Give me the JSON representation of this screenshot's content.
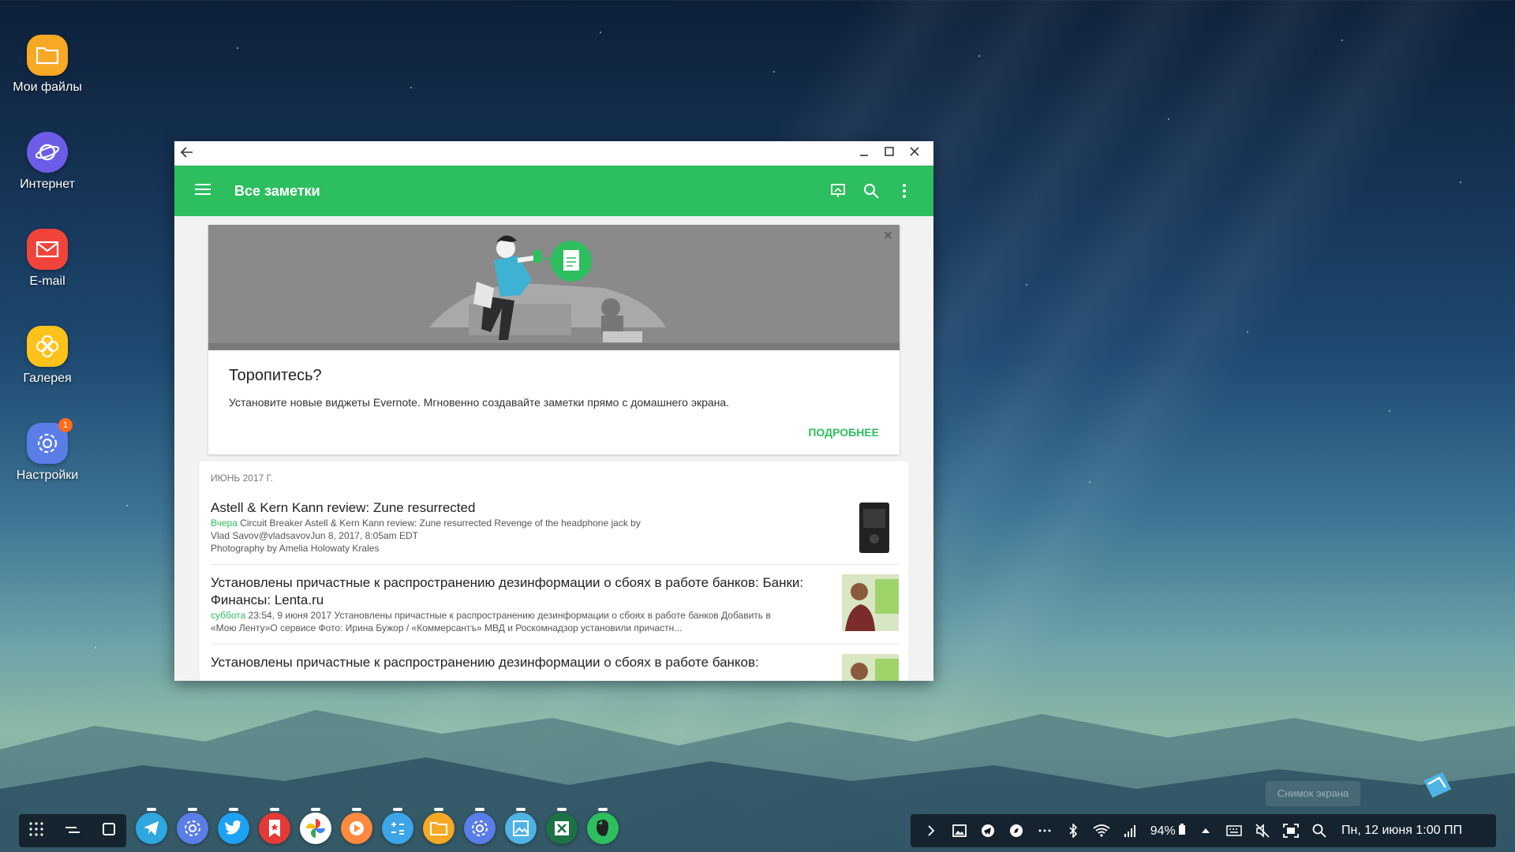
{
  "desktop": {
    "icons": [
      {
        "label": "Мои файлы",
        "icon": "folder-icon",
        "color": "#f7a824"
      },
      {
        "label": "Интернет",
        "icon": "planet-icon",
        "color": "#6c5ce7"
      },
      {
        "label": "E-mail",
        "icon": "mail-icon",
        "color": "#f0433a"
      },
      {
        "label": "Галерея",
        "icon": "flower-icon",
        "color": "#ffc21a"
      },
      {
        "label": "Настройки",
        "icon": "gear-icon",
        "color": "#5a7de8",
        "badge": "1"
      }
    ]
  },
  "window": {
    "back_icon": "back-arrow-icon",
    "minimize_icon": "minimize-icon",
    "maximize_icon": "maximize-icon",
    "close_icon": "close-icon"
  },
  "appbar": {
    "title": "Все заметки",
    "accent": "#2dbe60"
  },
  "promo": {
    "close": "✕",
    "heading": "Торопитесь?",
    "text": "Установите новые виджеты Evernote. Мгновенно создавайте заметки прямо с домашнего экрана.",
    "action": "ПОДРОБНЕЕ"
  },
  "notes": {
    "month": "ИЮНЬ 2017 Г.",
    "items": [
      {
        "title": "Astell & Kern Kann review: Zune resurrected",
        "date": "Вчера",
        "body_line1": " Circuit Breaker Astell & Kern Kann review: Zune resurrected Revenge of the headphone jack by",
        "body_line2": "Vlad Savov@vladsavovJun 8, 2017, 8:05am EDT",
        "body_line3": " Photography by Amelia Holowaty Krales"
      },
      {
        "title": "Установлены причастные к распространению дезинформации о сбоях в работе банков: Банки: Финансы: Lenta.ru",
        "date": "суббота",
        "body_line1": " 23:54, 9 июня 2017 Установлены причастные к распространению дезинформации о сбоях в работе банков Добавить в",
        "body_line2": "«Мою Ленту»О сервисе Фото: Ирина Бужор / «Коммерсантъ» МВД и Роскомнадзор установили причастн..."
      },
      {
        "title": "Установлены причастные к распространению дезинформации о сбоях в работе банков:"
      }
    ],
    "fab": "+"
  },
  "taskbar": {
    "dock_apps": [
      {
        "name": "telegram",
        "color": "#2ea6df"
      },
      {
        "name": "settings",
        "color": "#5a7de8"
      },
      {
        "name": "twitter",
        "color": "#1da1f2"
      },
      {
        "name": "bookmark",
        "color": "#e53935"
      },
      {
        "name": "photos",
        "color": "#ffffff"
      },
      {
        "name": "play-music",
        "color": "#ff8a3d"
      },
      {
        "name": "calculator",
        "color": "#3da5e8"
      },
      {
        "name": "my-files",
        "color": "#f7a824"
      },
      {
        "name": "settings-2",
        "color": "#5a7de8"
      },
      {
        "name": "gallery-frame",
        "color": "#4fb3e6"
      },
      {
        "name": "excel",
        "color": "#1e7145"
      },
      {
        "name": "evernote",
        "color": "#2dbe60"
      }
    ],
    "battery": "94%",
    "clock": "Пн, 12 июня  1:00 ПП",
    "toast": "Снимок экрана"
  }
}
